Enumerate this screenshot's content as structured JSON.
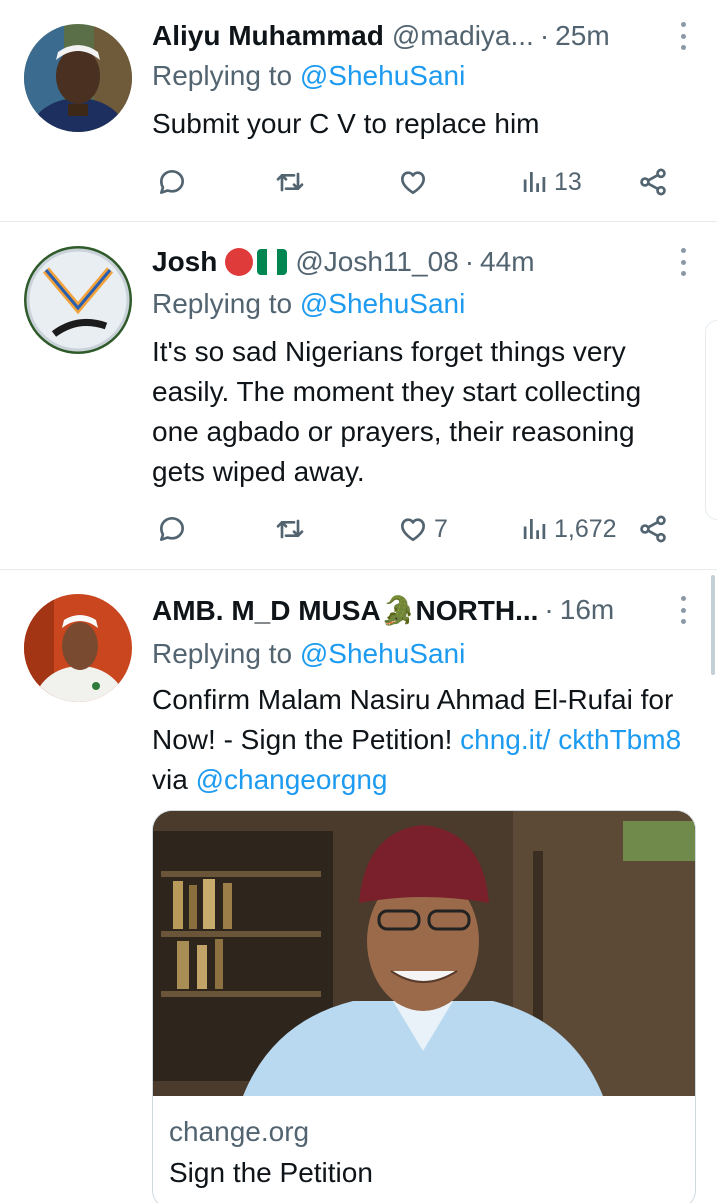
{
  "tweets": [
    {
      "name": "Aliyu Muhammad",
      "handle": "@madiya...",
      "time": "25m",
      "replying_prefix": "Replying to ",
      "replying_to": "@ShehuSani",
      "text": "Submit your C V to replace him",
      "likes": "",
      "views": "13"
    },
    {
      "name": "Josh",
      "handle": "@Josh11_08",
      "time": "44m",
      "replying_prefix": "Replying to ",
      "replying_to": "@ShehuSani",
      "text": "It's so sad Nigerians forget things very easily. The moment they start collecting one agbado or prayers, their reasoning gets wiped away.",
      "likes": "7",
      "views": "1,672"
    },
    {
      "name": "AMB. M_D MUSA🐊NORTH...",
      "handle": "",
      "time": "16m",
      "replying_prefix": "Replying to ",
      "replying_to": "@ShehuSani",
      "text_main": "Confirm Malam Nasiru Ahmad El-Rufai for Now! - Sign the Petition! ",
      "text_link1": "chng.it/ ckthTbm8",
      "text_via": " via ",
      "text_link2": "@changeorgng",
      "card_domain": "change.org",
      "card_title": "Sign the Petition"
    }
  ],
  "colors": {
    "accent": "#1d9bf0",
    "secondary_text": "#536471",
    "divider": "#e6ecf0",
    "flag_green": "#008751"
  },
  "icons": [
    "reply-icon",
    "retweet-icon",
    "like-icon",
    "views-icon",
    "share-icon",
    "more-icon"
  ]
}
